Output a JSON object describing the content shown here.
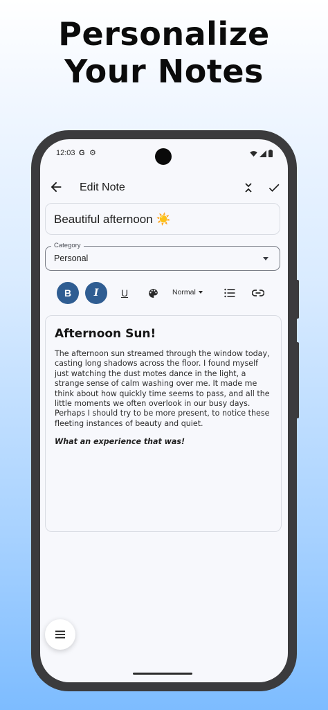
{
  "promo": {
    "line1": "Personalize",
    "line2": "Your Notes"
  },
  "status_bar": {
    "time": "12:03",
    "g_label": "G",
    "icons": [
      "gear-icon",
      "wifi-icon",
      "signal-icon",
      "battery-icon"
    ]
  },
  "app_bar": {
    "title": "Edit Note",
    "back_icon": "arrow-back-icon",
    "collapse_icon": "collapse-icon",
    "save_icon": "check-icon"
  },
  "note": {
    "title": "Beautiful afternoon ☀️",
    "category": {
      "label": "Category",
      "value": "Personal"
    }
  },
  "toolbar": {
    "bold": {
      "label": "B",
      "active": true
    },
    "italic": {
      "label": "I",
      "active": true
    },
    "underline": {
      "label": "U",
      "active": false
    },
    "palette_icon": "palette-icon",
    "text_size": "Normal",
    "list_icon": "bulleted-list-icon",
    "link_icon": "link-icon"
  },
  "editor": {
    "heading": "Afternoon Sun!",
    "body": "The afternoon sun streamed through the window today, casting long shadows across the floor. I found myself just watching the dust motes dance in the light, a strange sense of calm washing over me. It made me think about how quickly time seems to pass, and all the little moments we often overlook in our busy days. Perhaps I should try to be more present, to notice these fleeting instances of beauty and quiet.",
    "closing": "What an experience that was!"
  },
  "fab": {
    "icon": "menu-icon"
  },
  "colors": {
    "accent": "#2f5d92",
    "background_top": "#ffffff",
    "background_bottom": "#7dbcff",
    "frame": "#3b3b3d"
  }
}
